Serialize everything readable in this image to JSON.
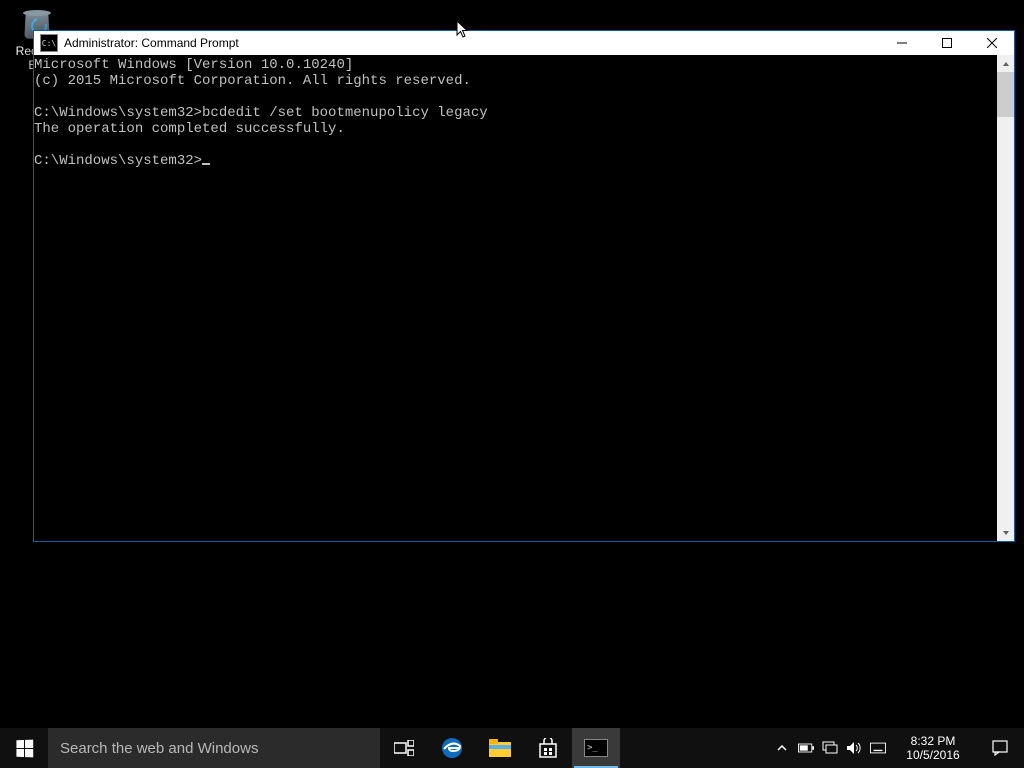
{
  "desktop": {
    "recycle_label": "Recycle Bin"
  },
  "window": {
    "title": "Administrator: Command Prompt",
    "icon_text": "C:\\",
    "console": {
      "line1": "Microsoft Windows [Version 10.0.10240]",
      "line2": "(c) 2015 Microsoft Corporation. All rights reserved.",
      "line3": "",
      "prompt1": "C:\\Windows\\system32>",
      "command1": "bcdedit /set bootmenupolicy legacy",
      "result1": "The operation completed successfully.",
      "line4": "",
      "prompt2": "C:\\Windows\\system32>"
    }
  },
  "taskbar": {
    "search_placeholder": "Search the web and Windows",
    "time": "8:32 PM",
    "date": "10/5/2016"
  }
}
